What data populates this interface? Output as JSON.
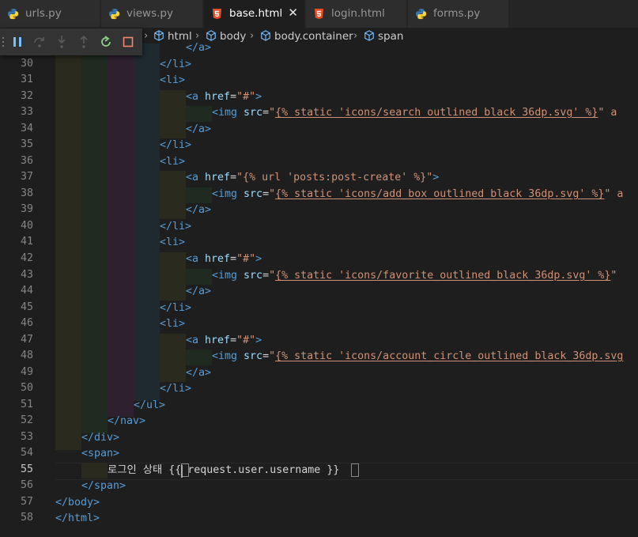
{
  "tabs": [
    {
      "label": "urls.py",
      "icon": "python-icon",
      "active": false
    },
    {
      "label": "views.py",
      "icon": "python-icon",
      "active": false
    },
    {
      "label": "base.html",
      "icon": "html5-icon",
      "active": true
    },
    {
      "label": "login.html",
      "icon": "html5-icon",
      "active": false
    },
    {
      "label": "forms.py",
      "icon": "python-icon",
      "active": false
    }
  ],
  "close_glyph": "✕",
  "breadcrumb": [
    "html",
    "body",
    "body.container",
    "span"
  ],
  "debug_toolbar": [
    "pause-icon",
    "step-over-icon",
    "step-into-icon",
    "step-out-icon",
    "restart-icon",
    "stop-icon"
  ],
  "colors": {
    "tag": "#569cd6",
    "attr": "#9cdcfe",
    "string": "#ce9178",
    "punct": "#808080",
    "text": "#d4d4d4",
    "html_icon": "#e44d26",
    "python_blue": "#3776ab",
    "python_yellow": "#ffd43b"
  },
  "line_numbers": [
    "30",
    "31",
    "32",
    "33",
    "34",
    "35",
    "36",
    "37",
    "38",
    "39",
    "40",
    "41",
    "42",
    "43",
    "44",
    "45",
    "46",
    "47",
    "48",
    "49",
    "50",
    "51",
    "52",
    "53",
    "54",
    "55",
    "56",
    "57",
    "58"
  ],
  "current_line": "55",
  "code": {
    "l29": "</a>",
    "l30": "</li>",
    "l31": "<li>",
    "l32a": "<a ",
    "l32b": "href",
    "l32c": "=",
    "l32d": "\"#\"",
    "l32e": ">",
    "l33a": "<img ",
    "l33b": "src",
    "l33c": "=",
    "l33d": "\"",
    "l33e": "{% static 'icons/search_outlined_black_36dp.svg' %}",
    "l33f": "\" a",
    "l34": "</a>",
    "l35": "</li>",
    "l36": "<li>",
    "l37a": "<a ",
    "l37b": "href",
    "l37c": "=",
    "l37d": "\"{% url 'posts:post-create' %}\"",
    "l37e": ">",
    "l38a": "<img ",
    "l38b": "src",
    "l38c": "=",
    "l38d": "\"",
    "l38e": "{% static 'icons/add_box_outlined_black_36dp.svg' %}",
    "l38f": "\" a",
    "l39": "</a>",
    "l40": "</li>",
    "l41": "<li>",
    "l42a": "<a ",
    "l42b": "href",
    "l42c": "=",
    "l42d": "\"#\"",
    "l42e": ">",
    "l43a": "<img ",
    "l43b": "src",
    "l43c": "=",
    "l43d": "\"",
    "l43e": "{% static 'icons/favorite_outlined_black_36dp.svg' %}",
    "l43f": "\"",
    "l44": "</a>",
    "l45": "</li>",
    "l46": "<li>",
    "l47a": "<a ",
    "l47b": "href",
    "l47c": "=",
    "l47d": "\"#\"",
    "l47e": ">",
    "l48a": "<img ",
    "l48b": "src",
    "l48c": "=",
    "l48d": "\"",
    "l48e": "{% static 'icons/account_circle_outlined_black_36dp.svg",
    "l49": "</a>",
    "l50": "</li>",
    "l51": "</ul>",
    "l52": "</nav>",
    "l53": "</div>",
    "l54": "<span>",
    "l55a": "로그인 상태 ",
    "l55b": "{{ request.user.username }}",
    "l56": "</span>",
    "l57": "</body>",
    "l58": "</html>"
  }
}
